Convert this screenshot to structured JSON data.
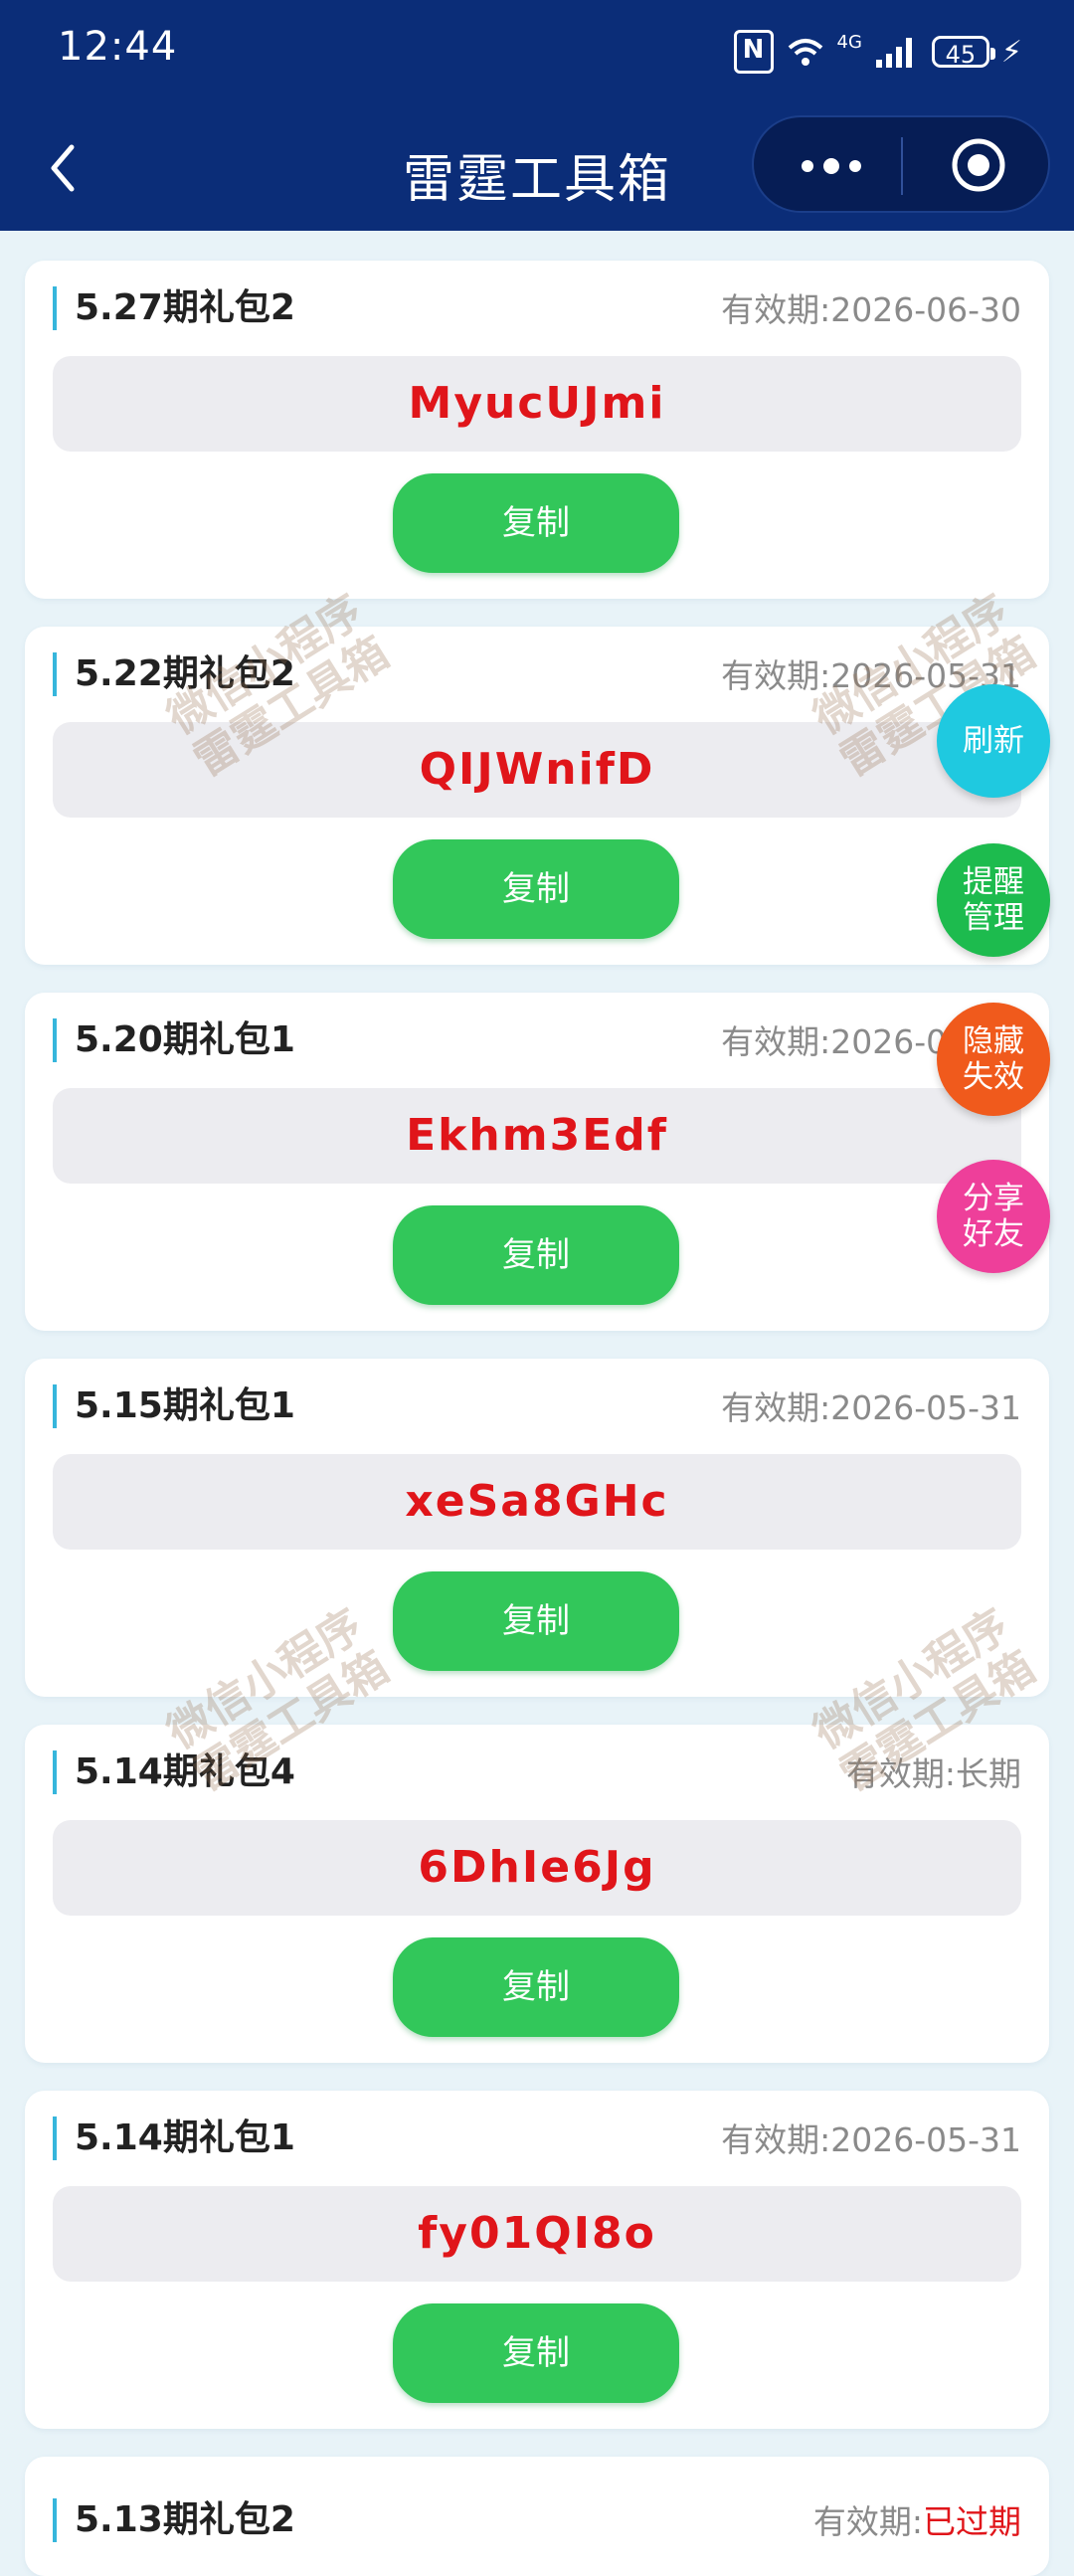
{
  "status_bar": {
    "time": "12:44",
    "battery": "45",
    "network_label": "4G"
  },
  "header": {
    "title": "雷霆工具箱",
    "capsule_more": "more-dots",
    "capsule_target": "target-circle"
  },
  "watermark": [
    "微信小程序",
    "雷霆工具箱"
  ],
  "cards": [
    {
      "name": "5.27期礼包2",
      "expiry_label": "有效期:",
      "expiry_value": "2026-06-30",
      "code": "MyucUJmi",
      "button": "复制"
    },
    {
      "name": "5.22期礼包2",
      "expiry_label": "有效期:",
      "expiry_value": "2026-05-31",
      "code": "QIJWnifD",
      "button": "复制"
    },
    {
      "name": "5.20期礼包1",
      "expiry_label": "有效期:",
      "expiry_value": "2026-05-31",
      "code": "Ekhm3Edf",
      "button": "复制"
    },
    {
      "name": "5.15期礼包1",
      "expiry_label": "有效期:",
      "expiry_value": "2026-05-31",
      "code": "xeSa8GHc",
      "button": "复制"
    },
    {
      "name": "5.14期礼包4",
      "expiry_label": "有效期:",
      "expiry_value": "长期",
      "code": "6DhIe6Jg",
      "button": "复制"
    },
    {
      "name": "5.14期礼包1",
      "expiry_label": "有效期:",
      "expiry_value": "2026-05-31",
      "code": "fy01QI8o",
      "button": "复制"
    }
  ],
  "partial_card": {
    "name": "5.13期礼包2",
    "expiry_label": "有效期:",
    "expiry_value": "已过期"
  },
  "fabs": {
    "refresh": "刷新",
    "reminder_line1": "提醒",
    "reminder_line2": "管理",
    "hide_line1": "隐藏",
    "hide_line2": "失效",
    "share_line1": "分享",
    "share_line2": "好友",
    "colors": {
      "refresh": "#1fc9e0",
      "reminder": "#1dbb4e",
      "hide": "#f05a1c",
      "share": "#ee3f9a"
    }
  },
  "colors": {
    "header_bg": "#0b2d78",
    "code_text": "#e0151a",
    "copy_button": "#32c75a",
    "title_accent": "#36b6dc"
  }
}
